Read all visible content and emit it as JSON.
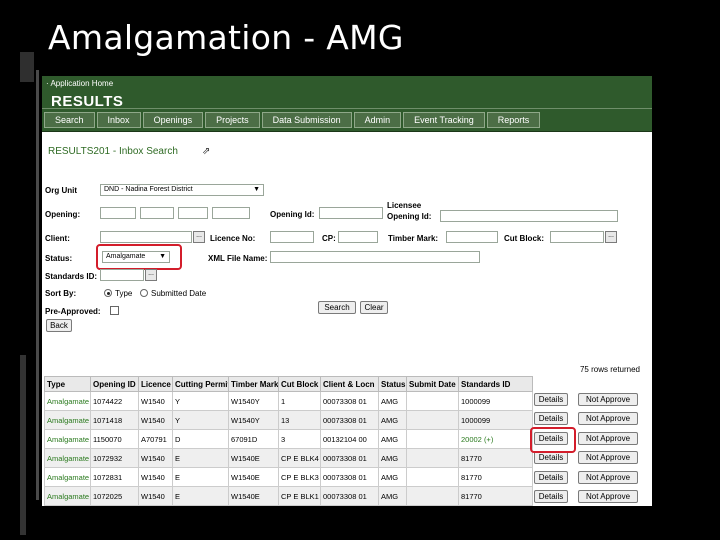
{
  "slide": {
    "title": "Amalgamation - AMG"
  },
  "app": {
    "home_link": "· Application Home",
    "title": "RESULTS",
    "nav": [
      "Search",
      "Inbox",
      "Openings",
      "Projects",
      "Data Submission",
      "Admin",
      "Event Tracking",
      "Reports"
    ],
    "screen_title": "RESULTS201 - Inbox Search"
  },
  "form": {
    "org_unit": {
      "label": "Org Unit",
      "value": "DND - Nadina Forest District"
    },
    "opening": {
      "label": "Opening:"
    },
    "opening_id": {
      "label": "Opening Id:"
    },
    "licensee_opening_id": {
      "label": "Licensee Opening Id:"
    },
    "client": {
      "label": "Client:"
    },
    "licence_no": {
      "label": "Licence No:"
    },
    "cp": {
      "label": "CP:"
    },
    "timber_mark": {
      "label": "Timber Mark:"
    },
    "cut_block": {
      "label": "Cut Block:"
    },
    "status": {
      "label": "Status:",
      "value": "Amalgamate"
    },
    "xml_file_name": {
      "label": "XML File Name:"
    },
    "standards_id": {
      "label": "Standards ID:"
    },
    "sort_by": {
      "label": "Sort By:",
      "options": [
        "Type",
        "Submitted Date"
      ],
      "selected": "Type"
    },
    "pre_approved": {
      "label": "Pre-Approved:"
    },
    "ellipsis": "...",
    "search_button": "Search",
    "clear_button": "Clear",
    "back_button": "Back"
  },
  "results": {
    "rows_returned": "75 rows returned",
    "columns": [
      "Type",
      "Opening ID",
      "Licence",
      "Cutting Permit",
      "Timber Mark",
      "Cut Block",
      "Client & Locn",
      "Status",
      "Submit Date",
      "Standards ID"
    ],
    "rows": [
      [
        "Amalgamate",
        "1074422",
        "W1540",
        "Y",
        "W1540Y",
        "1",
        "00073308 01",
        "AMG",
        "",
        "1000099"
      ],
      [
        "Amalgamate",
        "1071418",
        "W1540",
        "Y",
        "W1540Y",
        "13",
        "00073308 01",
        "AMG",
        "",
        "1000099"
      ],
      [
        "Amalgamate",
        "1150070",
        "A70791",
        "D",
        "67091D",
        "3",
        "00132104 00",
        "AMG",
        "",
        "20002 (+)"
      ],
      [
        "Amalgamate",
        "1072932",
        "W1540",
        "E",
        "W1540E",
        "CP E BLK4",
        "00073308 01",
        "AMG",
        "",
        "81770"
      ],
      [
        "Amalgamate",
        "1072831",
        "W1540",
        "E",
        "W1540E",
        "CP E BLK3",
        "00073308 01",
        "AMG",
        "",
        "81770"
      ],
      [
        "Amalgamate",
        "1072025",
        "W1540",
        "E",
        "W1540E",
        "CP E BLK1",
        "00073308 01",
        "AMG",
        "",
        "81770"
      ]
    ],
    "details_label": "Details",
    "not_approve_label": "Not Approve"
  },
  "colors": {
    "header_green": "#2f5a2c",
    "highlight_red": "#d31d2b",
    "link_green": "#2a7a1e"
  }
}
